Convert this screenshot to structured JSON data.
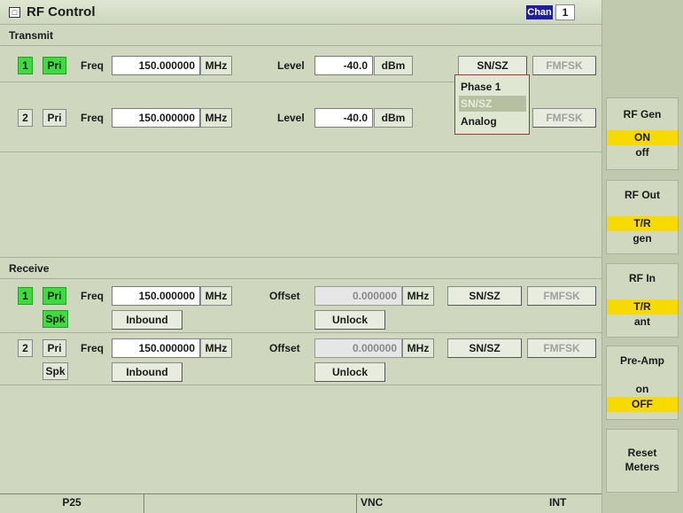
{
  "window": {
    "title": "RF Control",
    "chan_label": "Chan",
    "chan_value": "1"
  },
  "transmit": {
    "title": "Transmit",
    "rows": [
      {
        "num": "1",
        "pri": "Pri",
        "freq_label": "Freq",
        "freq": "150.000000",
        "freq_unit": "MHz",
        "level_label": "Level",
        "level": "-40.0",
        "level_unit": "dBm",
        "mode": "SN/SZ",
        "fmfsk": "FMFSK"
      },
      {
        "num": "2",
        "pri": "Pri",
        "freq_label": "Freq",
        "freq": "150.000000",
        "freq_unit": "MHz",
        "level_label": "Level",
        "level": "-40.0",
        "level_unit": "dBm",
        "mode": "SN/SZ",
        "fmfsk": "FMFSK"
      }
    ],
    "dropdown": [
      "Phase 1",
      "SN/SZ",
      "Analog"
    ]
  },
  "receive": {
    "title": "Receive",
    "rows": [
      {
        "num": "1",
        "pri": "Pri",
        "spk": "Spk",
        "freq_label": "Freq",
        "freq": "150.000000",
        "freq_unit": "MHz",
        "offset_label": "Offset",
        "offset": "0.000000",
        "offset_unit": "MHz",
        "mode": "SN/SZ",
        "fmfsk": "FMFSK",
        "inbound": "Inbound",
        "unlock": "Unlock"
      },
      {
        "num": "2",
        "pri": "Pri",
        "spk": "Spk",
        "freq_label": "Freq",
        "freq": "150.000000",
        "freq_unit": "MHz",
        "offset_label": "Offset",
        "offset": "0.000000",
        "offset_unit": "MHz",
        "mode": "SN/SZ",
        "fmfsk": "FMFSK",
        "inbound": "Inbound",
        "unlock": "Unlock"
      }
    ]
  },
  "side": {
    "rf_gen": {
      "label": "RF Gen",
      "on": "ON",
      "off": "off"
    },
    "rf_out": {
      "label": "RF Out",
      "a": "T/R",
      "b": "gen"
    },
    "rf_in": {
      "label": "RF In",
      "a": "T/R",
      "b": "ant"
    },
    "preamp": {
      "label": "Pre-Amp",
      "a": "on",
      "b": "OFF"
    },
    "reset": {
      "line1": "Reset",
      "line2": "Meters"
    }
  },
  "status": {
    "mode": "P25",
    "middle": "",
    "vnc": "VNC",
    "ref": "INT"
  },
  "colors": {
    "active_green": "#3ddc3d",
    "highlight_yellow": "#f7da00",
    "chan_blue": "#1e1e9e"
  }
}
